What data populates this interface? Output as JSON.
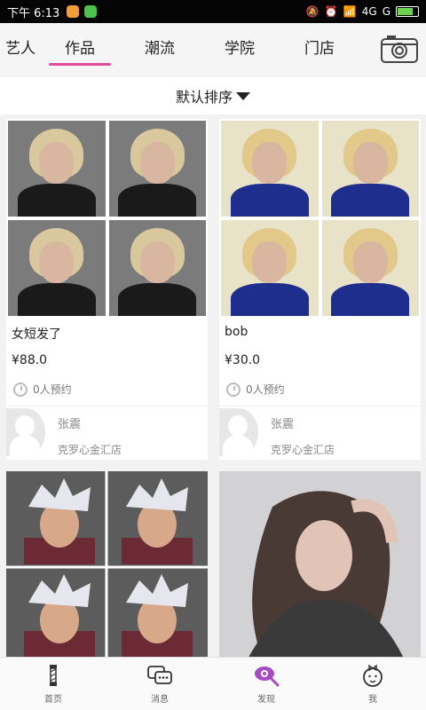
{
  "status_bar": {
    "time": "下午 6:13",
    "network": "4G",
    "carrier_suffix": "G"
  },
  "top_tabs": [
    "艺人",
    "作品",
    "潮流",
    "学院",
    "门店"
  ],
  "active_tab": "作品",
  "sort": {
    "label": "默认排序"
  },
  "cards": [
    {
      "title": "女短发了",
      "price": "¥88.0",
      "booked": "0人预约",
      "artist": "张震",
      "store": "克罗心金汇店"
    },
    {
      "title": "bob",
      "price": "¥30.0",
      "booked": "0人预约",
      "artist": "张震",
      "store": "克罗心金汇店"
    }
  ],
  "bottom_nav": [
    {
      "label": "首页",
      "icon": "barber-pole-icon"
    },
    {
      "label": "消息",
      "icon": "chat-bubbles-icon"
    },
    {
      "label": "发现",
      "icon": "eye-search-icon",
      "active": true
    },
    {
      "label": "我",
      "icon": "girl-face-icon"
    }
  ],
  "colors": {
    "accent": "#e24aa0",
    "active_icon": "#a64bc2"
  }
}
